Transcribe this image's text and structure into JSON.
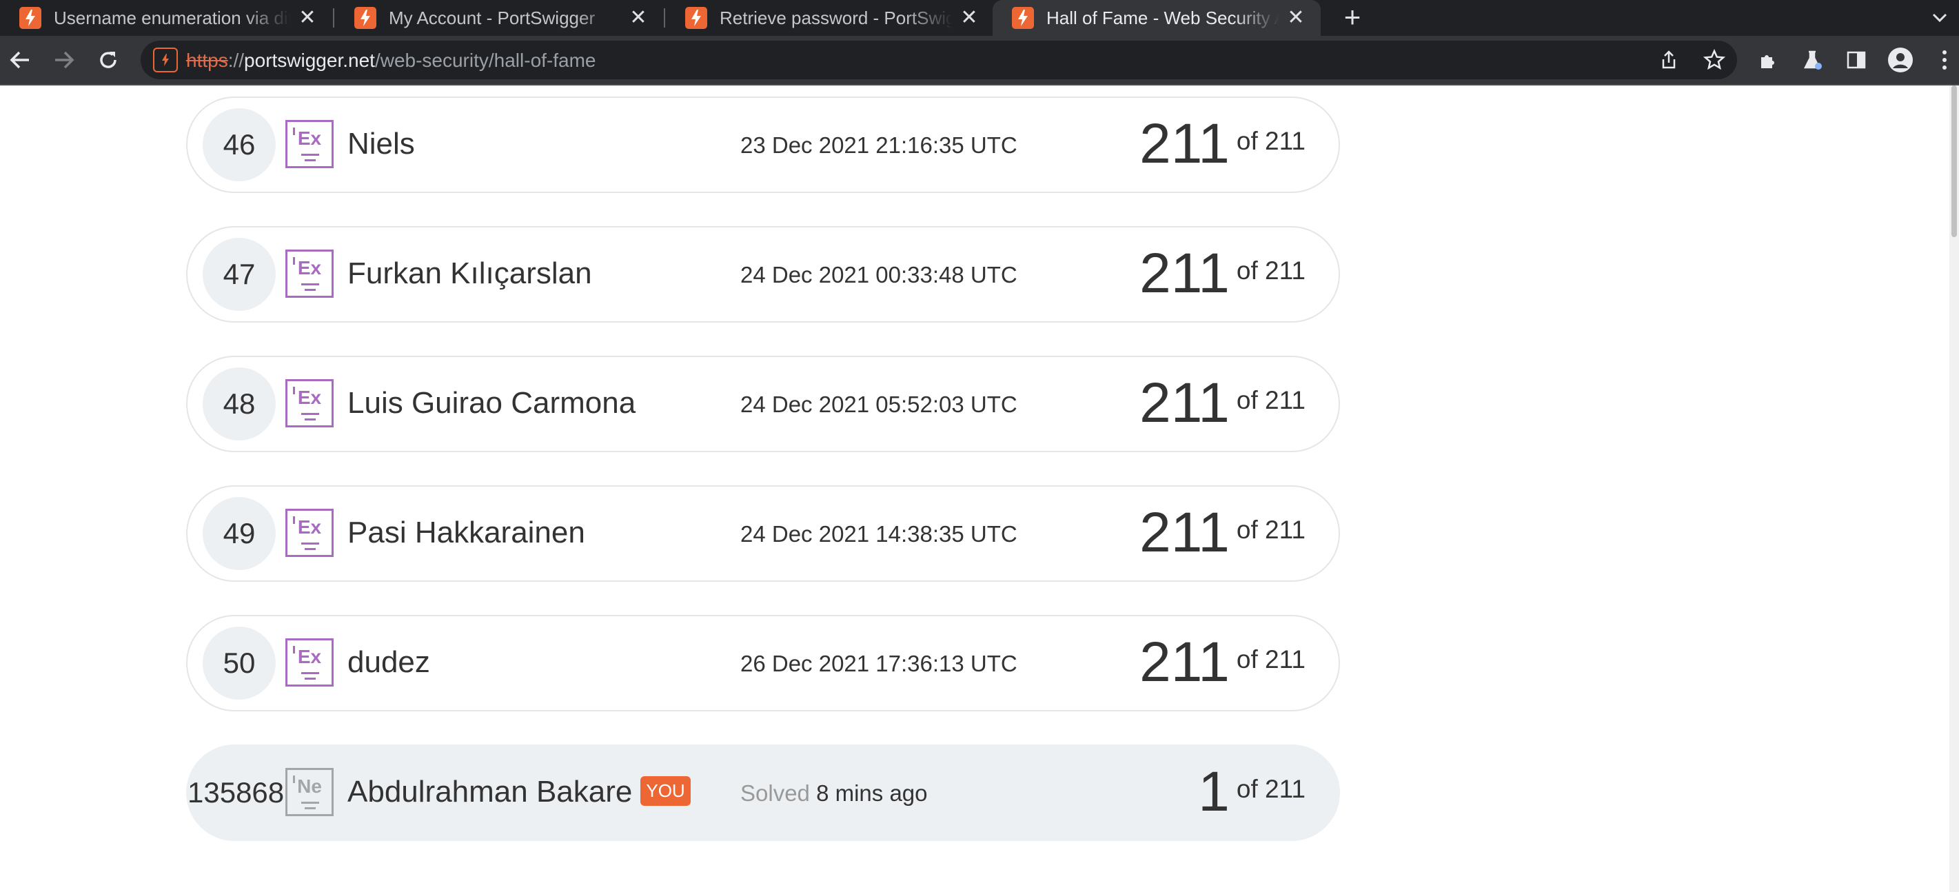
{
  "browser": {
    "tabs": [
      {
        "title": "Username enumeration via different responses",
        "active": false
      },
      {
        "title": "My Account - PortSwigger",
        "active": false
      },
      {
        "title": "Retrieve password - PortSwigger",
        "active": false
      },
      {
        "title": "Hall of Fame - Web Security Academy",
        "active": true
      }
    ],
    "url": {
      "scheme": "https",
      "separator": "://",
      "host": "portswigger.net",
      "path": "/web-security/hall-of-fame"
    }
  },
  "leaderboard": {
    "rows": [
      {
        "rank": "46",
        "level": "Ex",
        "name": "Niels",
        "date": "23 Dec 2021 21:16:35 UTC",
        "solved": "211",
        "total": "of 211"
      },
      {
        "rank": "47",
        "level": "Ex",
        "name": "Furkan Kılıçarslan",
        "date": "24 Dec 2021 00:33:48 UTC",
        "solved": "211",
        "total": "of 211"
      },
      {
        "rank": "48",
        "level": "Ex",
        "name": "Luis Guirao Carmona",
        "date": "24 Dec 2021 05:52:03 UTC",
        "solved": "211",
        "total": "of 211"
      },
      {
        "rank": "49",
        "level": "Ex",
        "name": "Pasi Hakkarainen",
        "date": "24 Dec 2021 14:38:35 UTC",
        "solved": "211",
        "total": "of 211"
      },
      {
        "rank": "50",
        "level": "Ex",
        "name": "dudez",
        "date": "26 Dec 2021 17:36:13 UTC",
        "solved": "211",
        "total": "of 211"
      }
    ],
    "you_row": {
      "rank": "135868",
      "level": "Ne",
      "name": "Abdulrahman Bakare",
      "you_label": "YOU",
      "date_prefix": "Solved",
      "date_value": "8 mins ago",
      "solved": "1",
      "total": "of 211"
    }
  },
  "colors": {
    "accent": "#ed6735",
    "expert_badge": "#a96ac2",
    "novice_badge": "#a3a6a8",
    "row_highlight": "#edf0f2"
  }
}
